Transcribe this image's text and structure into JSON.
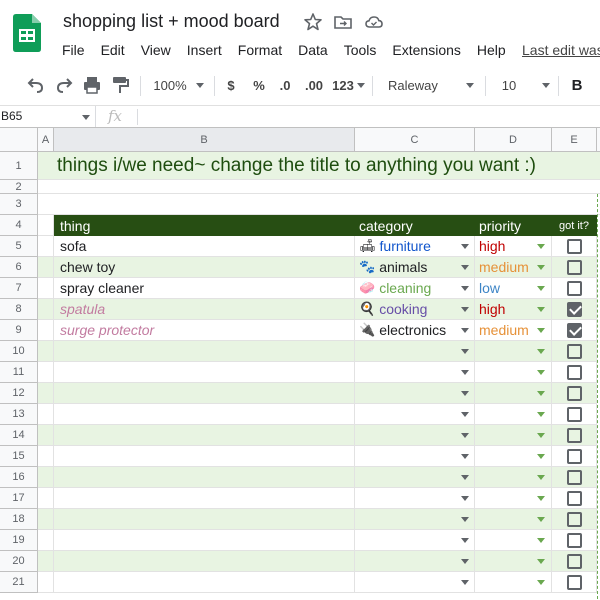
{
  "app": {
    "title": "shopping list + mood board",
    "menu": [
      "File",
      "Edit",
      "View",
      "Insert",
      "Format",
      "Data",
      "Tools",
      "Extensions",
      "Help"
    ],
    "last_edit": "Last edit was"
  },
  "toolbar": {
    "zoom": "100%",
    "currency": "$",
    "percent": "%",
    "dec_less": ".0",
    "dec_more": ".00",
    "more_formats": "123",
    "font": "Raleway",
    "font_size": "10",
    "bold": "B"
  },
  "formula_bar": {
    "name_box": "B65",
    "fx": "fx",
    "value": ""
  },
  "columns": [
    "A",
    "B",
    "C",
    "D",
    "E"
  ],
  "rows": [
    "1",
    "2",
    "3",
    "4",
    "5",
    "6",
    "7",
    "8",
    "9",
    "10",
    "11",
    "12",
    "13",
    "14",
    "15",
    "16",
    "17",
    "18",
    "19",
    "20",
    "21"
  ],
  "banner": "things i/we need~ change the title to anything you want :)",
  "table_header": {
    "thing": "thing",
    "category": "category",
    "priority": "priority",
    "got_it": "got it?"
  },
  "items": [
    {
      "thing": "sofa",
      "category": "furniture",
      "category_icon": "couch-icon",
      "priority": "high",
      "checked": false,
      "done": false
    },
    {
      "thing": "chew toy",
      "category": "animals",
      "category_icon": "paw-icon",
      "priority": "medium",
      "checked": false,
      "done": false
    },
    {
      "thing": "spray cleaner",
      "category": "cleaning",
      "category_icon": "soap-icon",
      "priority": "low",
      "checked": false,
      "done": false
    },
    {
      "thing": "spatula",
      "category": "cooking",
      "category_icon": "pan-icon",
      "priority": "high",
      "checked": true,
      "done": true
    },
    {
      "thing": "surge protector",
      "category": "electronics",
      "category_icon": "plug-icon",
      "priority": "medium",
      "checked": true,
      "done": true
    }
  ],
  "colors": {
    "header_bg": "#274e13",
    "band_bg": "#e8f4e2",
    "high": "#c00000",
    "medium": "#e69138",
    "low": "#3d85c6",
    "furniture": "#1155cc",
    "animals": "#202124",
    "cleaning": "#6aa84f",
    "cooking": "#674ea7",
    "electronics": "#202124",
    "done_text": "#c27ba0"
  }
}
